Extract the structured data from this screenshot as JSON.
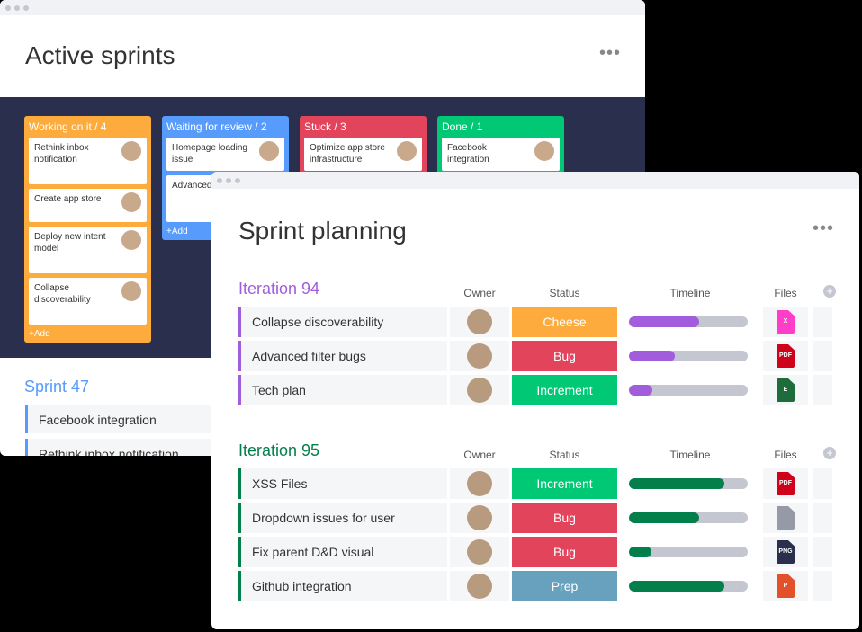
{
  "back": {
    "title": "Active sprints",
    "columns": [
      {
        "label": "Working on it / 4",
        "color": "#fdab3d",
        "cards": [
          "Rethink inbox notification",
          "Create app store",
          "Deploy new intent model",
          "Collapse discoverability"
        ],
        "add": "+Add"
      },
      {
        "label": "Waiting for review / 2",
        "color": "#579bfc",
        "cards": [
          "Homepage loading issue",
          "Advanced bugs"
        ],
        "add": "+Add"
      },
      {
        "label": "Stuck / 3",
        "color": "#e2445c",
        "cards": [
          "Optimize app store infrastructure"
        ]
      },
      {
        "label": "Done / 1",
        "color": "#00c875",
        "cards": [
          "Facebook integration"
        ]
      }
    ],
    "sprint": {
      "title": "Sprint 47",
      "items": [
        "Facebook integration",
        "Rethink inbox notification"
      ]
    }
  },
  "front": {
    "title": "Sprint planning",
    "columns": {
      "owner": "Owner",
      "status": "Status",
      "timeline": "Timeline",
      "files": "Files"
    },
    "groups": [
      {
        "name": "Iteration 94",
        "color": "#a25ddc",
        "rows": [
          {
            "name": "Collapse discoverability",
            "status": "Cheese",
            "status_color": "#fdab3d",
            "progress": 59,
            "file": "X",
            "file_color": "#ff3dc8"
          },
          {
            "name": "Advanced filter bugs",
            "status": "Bug",
            "status_color": "#e2445c",
            "progress": 39,
            "file": "PDF",
            "file_color": "#d0021b"
          },
          {
            "name": "Tech plan",
            "status": "Increment",
            "status_color": "#00c875",
            "progress": 20,
            "file": "E",
            "file_color": "#1e6c3b"
          }
        ]
      },
      {
        "name": "Iteration 95",
        "color": "#037f4c",
        "rows": [
          {
            "name": "XSS Files",
            "status": "Increment",
            "status_color": "#00c875",
            "progress": 80,
            "file": "PDF",
            "file_color": "#d0021b"
          },
          {
            "name": "Dropdown issues for user",
            "status": "Bug",
            "status_color": "#e2445c",
            "progress": 59,
            "file": "",
            "file_color": "#9699a6"
          },
          {
            "name": "Fix parent D&D visual",
            "status": "Bug",
            "status_color": "#e2445c",
            "progress": 19,
            "file": "PNG",
            "file_color": "#292f4c"
          },
          {
            "name": "Github integration",
            "status": "Prep",
            "status_color": "#68a1bd",
            "progress": 80,
            "file": "P",
            "file_color": "#e2512a"
          }
        ]
      }
    ]
  }
}
